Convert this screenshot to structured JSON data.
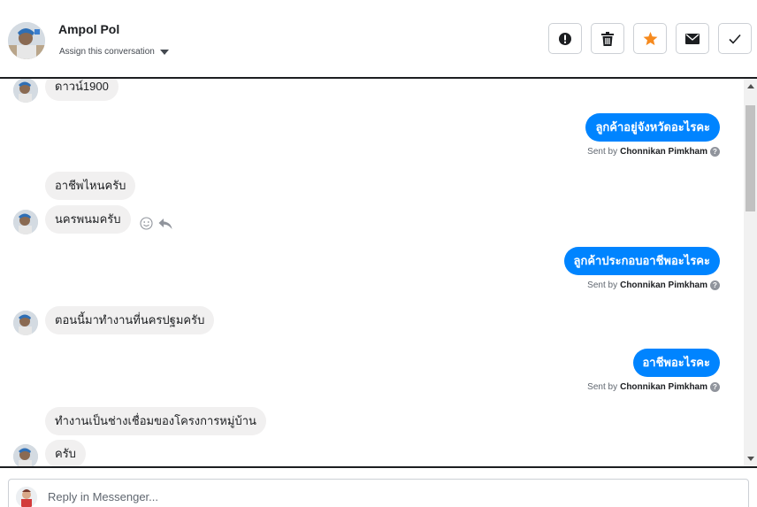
{
  "header": {
    "contact_name": "Ampol Pol",
    "assign_label": "Assign this conversation",
    "actions": [
      {
        "name": "spam-button",
        "icon": "alert-circle-icon"
      },
      {
        "name": "delete-button",
        "icon": "trash-icon"
      },
      {
        "name": "star-button",
        "icon": "star-icon",
        "color": "#f68a1e"
      },
      {
        "name": "mark-unread-button",
        "icon": "envelope-icon"
      },
      {
        "name": "mark-done-button",
        "icon": "checkmark-icon"
      }
    ]
  },
  "messages": [
    {
      "direction": "in",
      "text": "ดาวน์1900"
    },
    {
      "direction": "out",
      "text": "ลูกค้าอยู่จังหวัดอะไรคะ",
      "sent_by_prefix": "Sent by",
      "sent_by_name": "Chonnikan Pimkham"
    },
    {
      "direction": "in",
      "text": "อาชีพไหนครับ"
    },
    {
      "direction": "in",
      "text": "นครพนมครับ"
    },
    {
      "direction": "out",
      "text": "ลูกค้าประกอบอาชีพอะไรคะ",
      "sent_by_prefix": "Sent by",
      "sent_by_name": "Chonnikan Pimkham"
    },
    {
      "direction": "in",
      "text": "ตอนนี้มาทำงานที่นครปฐมครับ"
    },
    {
      "direction": "out",
      "text": "อาชีพอะไรคะ",
      "sent_by_prefix": "Sent by",
      "sent_by_name": "Chonnikan Pimkham"
    },
    {
      "direction": "in",
      "text": "ทำงานเป็นช่างเชื่อมของโครงการหมู่บ้าน"
    },
    {
      "direction": "in",
      "text": "ครับ"
    }
  ],
  "composer": {
    "placeholder": "Reply in Messenger..."
  },
  "colors": {
    "outgoing_bubble": "#0084ff",
    "incoming_bubble": "#f1f0f0",
    "star": "#f68a1e"
  }
}
